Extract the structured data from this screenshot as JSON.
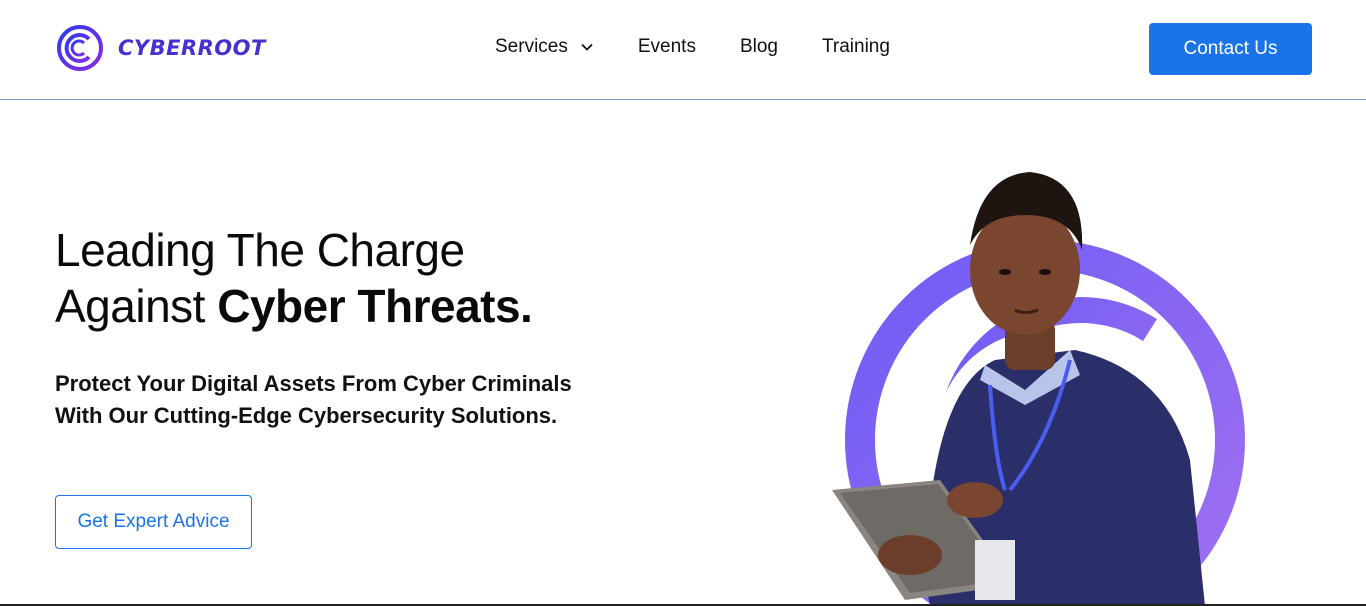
{
  "brand": {
    "name": "CYBERROOT"
  },
  "nav": {
    "items": [
      {
        "label": "Services",
        "has_dropdown": true
      },
      {
        "label": "Events"
      },
      {
        "label": "Blog"
      },
      {
        "label": "Training"
      }
    ],
    "contact_label": "Contact Us"
  },
  "hero": {
    "title_line1": "Leading The Charge",
    "title_line2_prefix": "Against ",
    "title_line2_bold": "Cyber Threats.",
    "subtitle": "Protect Your Digital Assets From Cyber Criminals With Our Cutting-Edge Cybersecurity Solutions.",
    "cta_label": "Get Expert Advice"
  },
  "icons": {
    "logo": "cyberroot-logo-icon",
    "dropdown": "chevron-down-icon",
    "hero": "hero-person-illustration"
  },
  "colors": {
    "accent": "#1a73e8",
    "brand": "#4a2fd0",
    "ring": "#8a5cf0"
  }
}
